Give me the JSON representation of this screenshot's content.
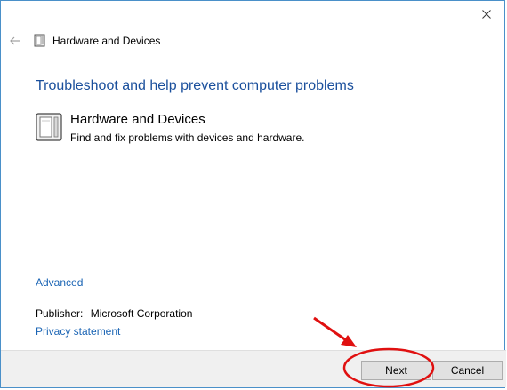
{
  "window": {
    "title": "Hardware and Devices"
  },
  "main": {
    "heading": "Troubleshoot and help prevent computer problems",
    "tool": {
      "name": "Hardware and Devices",
      "description": "Find and fix problems with devices and hardware."
    },
    "advanced_link": "Advanced",
    "publisher_label": "Publisher:",
    "publisher_value": "Microsoft Corporation",
    "privacy_link": "Privacy statement"
  },
  "footer": {
    "next_label": "Next",
    "cancel_label": "Cancel"
  },
  "icons": {
    "close": "close-icon",
    "back": "back-arrow-icon",
    "troubleshooter": "hardware-device-icon"
  },
  "colors": {
    "heading": "#1a4f9c",
    "link": "#1a64b4",
    "annotation": "#e01010"
  }
}
